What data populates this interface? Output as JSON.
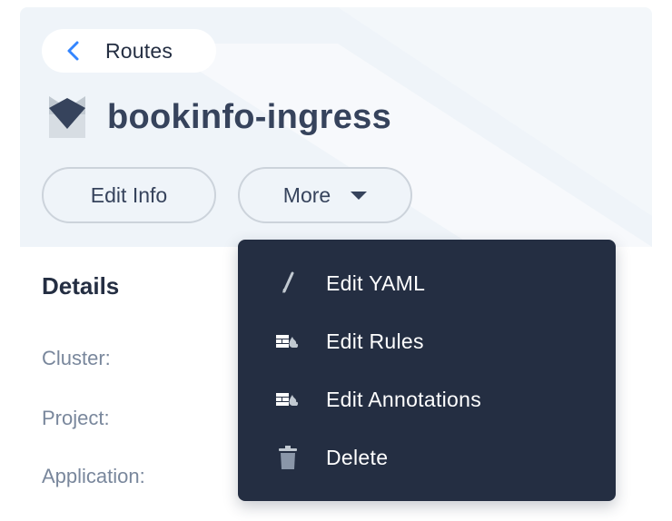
{
  "breadcrumb": {
    "back_label": "Routes"
  },
  "resource": {
    "name": "bookinfo-ingress"
  },
  "actions": {
    "edit_info_label": "Edit Info",
    "more_label": "More"
  },
  "details": {
    "title": "Details",
    "fields": [
      {
        "label": "Cluster:"
      },
      {
        "label": "Project:"
      },
      {
        "label": "Application:"
      }
    ]
  },
  "more_menu": {
    "items": [
      {
        "label": "Edit YAML",
        "icon": "pen-icon"
      },
      {
        "label": "Edit Rules",
        "icon": "firewall-icon"
      },
      {
        "label": "Edit Annotations",
        "icon": "firewall-icon"
      },
      {
        "label": "Delete",
        "icon": "trash-icon"
      }
    ]
  },
  "colors": {
    "header_bg": "#eff4f9",
    "title_text": "#36435c",
    "menu_bg": "#242e42",
    "back_chevron": "#3385ff",
    "muted_label": "#79879c"
  }
}
